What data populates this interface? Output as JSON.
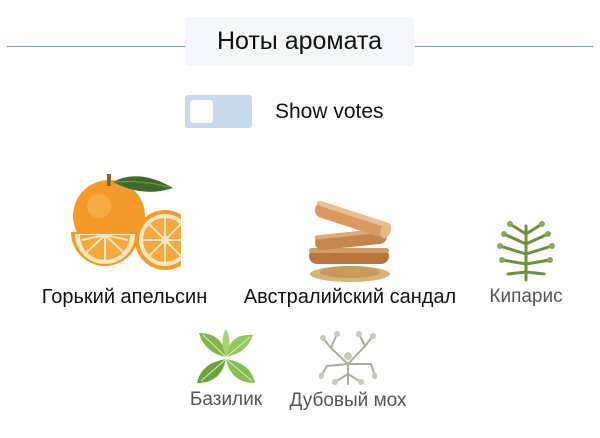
{
  "header": {
    "title": "Ноты аромата"
  },
  "toggle": {
    "label": "Show votes",
    "on": false
  },
  "notes": [
    {
      "name": "Горький апельсин",
      "icon": "bitter-orange-icon",
      "emphasis": "strong"
    },
    {
      "name": "Австралийский сандал",
      "icon": "sandalwood-icon",
      "emphasis": "strong"
    },
    {
      "name": "Кипарис",
      "icon": "cypress-icon",
      "emphasis": "light"
    },
    {
      "name": "Базилик",
      "icon": "basil-icon",
      "emphasis": "light"
    },
    {
      "name": "Дубовый мох",
      "icon": "oakmoss-icon",
      "emphasis": "light"
    }
  ],
  "colors": {
    "rule": "#7f97bd",
    "title_bg": "#f3f6fb",
    "toggle_bg": "#c9d9ec",
    "strong_text": "#111111",
    "light_text": "#555555"
  }
}
